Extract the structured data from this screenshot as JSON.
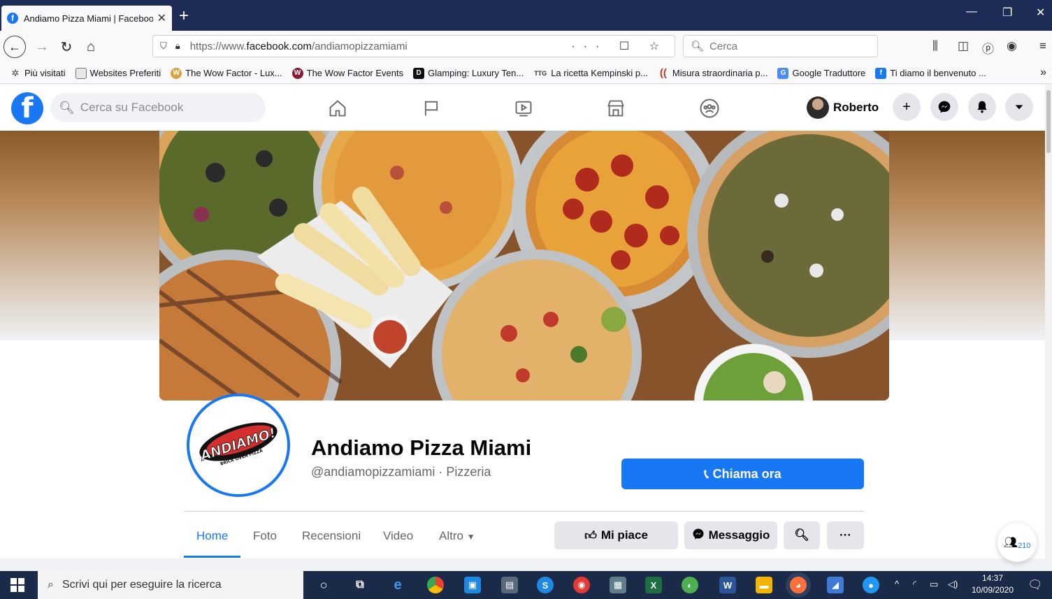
{
  "browser": {
    "tab_title": "Andiamo Pizza Miami | Facebook",
    "tab_close": "✕",
    "new_tab": "+",
    "url_prefix": "https://www.",
    "url_domain": "facebook.com",
    "url_path": "/andiamopizzamiami",
    "url_actions": "··· ☐ ☆",
    "search_placeholder": "Cerca"
  },
  "bookmarks": [
    {
      "label": "Più visitati",
      "icon": "gear-icon",
      "color": "#555555"
    },
    {
      "label": "Websites Preferiti",
      "icon": "folder-icon",
      "color": "#666666"
    },
    {
      "label": "The Wow Factor - Lux...",
      "icon": "w-icon",
      "color": "#d9a441"
    },
    {
      "label": "The Wow Factor Events",
      "icon": "w-icon",
      "color": "#8b1a3a"
    },
    {
      "label": "Glamping: Luxury Ten...",
      "icon": "d-icon",
      "color": "#111111"
    },
    {
      "label": "La ricetta Kempinski p...",
      "icon": "ttg-icon",
      "color": "#333333"
    },
    {
      "label": "Misura straordinaria p...",
      "icon": "c-icon",
      "color": "#c0392b"
    },
    {
      "label": "Google Traduttore",
      "icon": "translate-icon",
      "color": "#4a8af4"
    },
    {
      "label": "Ti diamo il benvenuto ...",
      "icon": "facebook-icon",
      "color": "#1877f2"
    }
  ],
  "facebook": {
    "search_placeholder": "Cerca su Facebook",
    "user_name": "Roberto",
    "brand_color": "#1877f2"
  },
  "page": {
    "name": "Andiamo Pizza Miami",
    "handle": "@andiamopizzamiami · Pizzeria",
    "logo_text": "ANDIAMO!",
    "logo_subtext": "BRICK OVEN PIZZA",
    "call_button": "Chiama ora",
    "tabs": [
      {
        "label": "Home",
        "active": true
      },
      {
        "label": "Foto",
        "active": false
      },
      {
        "label": "Recensioni",
        "active": false
      },
      {
        "label": "Video",
        "active": false
      },
      {
        "label": "Altro",
        "active": false
      }
    ],
    "like_button": "Mi piace",
    "message_button": "Messaggio",
    "friends_count": "210"
  },
  "taskbar": {
    "search_placeholder": "Scrivi qui per eseguire la ricerca",
    "time": "14:37",
    "date": "10/09/2020"
  }
}
